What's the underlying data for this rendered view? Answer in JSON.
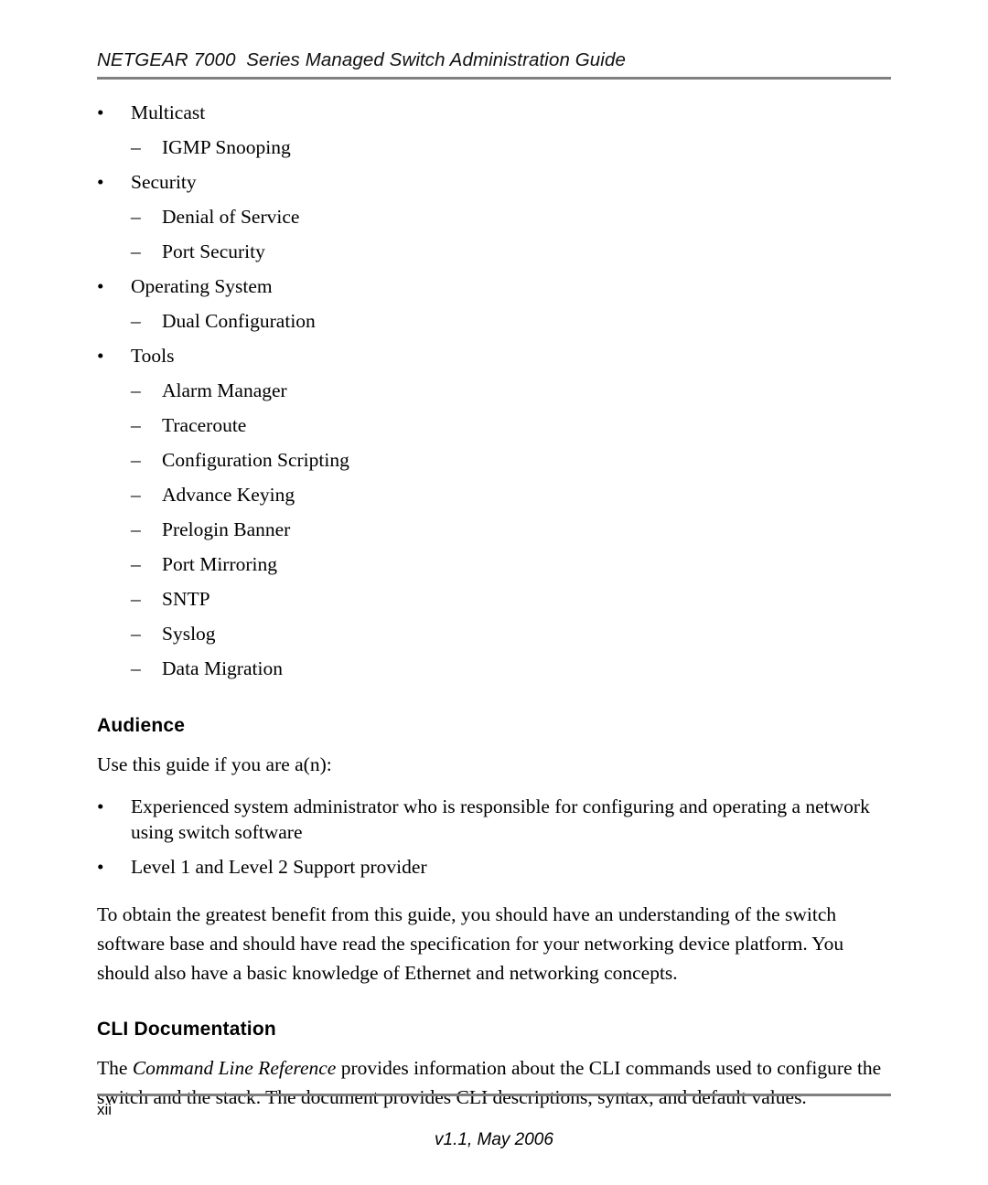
{
  "header": {
    "title": "NETGEAR 7000  Series Managed Switch Administration Guide"
  },
  "feature_list": {
    "groups": [
      {
        "label": "Multicast",
        "items": [
          "IGMP Snooping"
        ]
      },
      {
        "label": "Security",
        "items": [
          "Denial of Service",
          "Port Security"
        ]
      },
      {
        "label": "Operating System",
        "items": [
          "Dual Configuration"
        ]
      },
      {
        "label": "Tools",
        "items": [
          "Alarm Manager",
          "Traceroute",
          "Configuration Scripting",
          "Advance Keying",
          "Prelogin Banner",
          "Port Mirroring",
          "SNTP",
          "Syslog",
          "Data Migration"
        ]
      }
    ]
  },
  "audience": {
    "heading": "Audience",
    "intro": "Use this guide if you are a(n):",
    "bullets": [
      "Experienced system administrator who is responsible for configuring and operating a network using switch software",
      "Level 1 and Level 2 Support provider"
    ],
    "paragraph": "To obtain the greatest benefit from this guide, you should have an understanding of the switch software base and should have read the specification for your networking device platform. You should also have a basic knowledge of Ethernet and networking concepts."
  },
  "cli_documentation": {
    "heading": "CLI Documentation",
    "paragraph_before": "The ",
    "paragraph_italic": "Command Line Reference",
    "paragraph_after": " provides information about the CLI commands used to configure the switch and the stack. The document provides CLI descriptions, syntax, and default values."
  },
  "footer": {
    "page_number": "xii",
    "version": "v1.1, May 2006"
  },
  "markers": {
    "bullet": "•",
    "dash": "–"
  },
  "colors": {
    "rule": "#808080",
    "text": "#000000",
    "background": "#ffffff"
  }
}
